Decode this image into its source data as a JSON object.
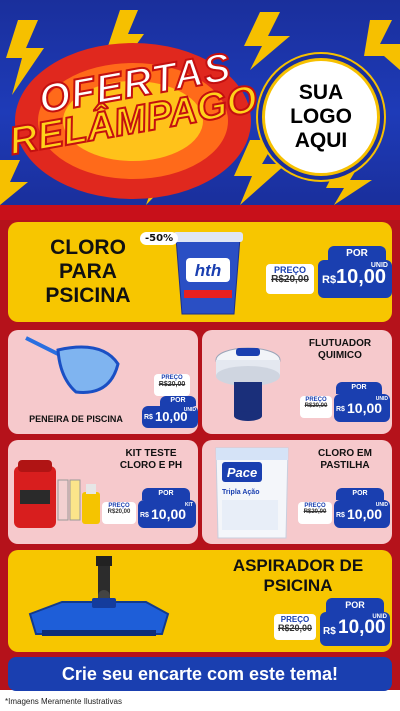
{
  "header": {
    "title_line1": "OFERTAS",
    "title_line2": "RELÂMPAGO",
    "logo_line1": "SUA",
    "logo_line2": "LOGO",
    "logo_line3": "AQUI"
  },
  "products": {
    "cloro": {
      "name_line1": "CLORO",
      "name_line2": "PARA",
      "name_line3": "PSICINA",
      "discount": "-50%",
      "brand": "hth",
      "por": "POR",
      "preco": "PREÇO",
      "old_price": "R$20,00",
      "currency": "R$",
      "price": "10,00",
      "unit": "UNID"
    },
    "peneira": {
      "name": "PENEIRA DE PISCINA",
      "por": "POR",
      "preco": "PREÇO",
      "old_price": "R$20,00",
      "currency": "R$",
      "price": "10,00",
      "unit": "UNID"
    },
    "flutuador": {
      "name_line1": "FLUTUADOR",
      "name_line2": "QUIMICO",
      "por": "POR",
      "preco": "PREÇO",
      "old_price": "R$20,00",
      "currency": "R$",
      "price": "10,00",
      "unit": "UNID"
    },
    "kit": {
      "name_line1": "KIT TESTE",
      "name_line2": "CLORO E PH",
      "por": "POR",
      "preco": "PREÇO",
      "old_price": "R$20,00",
      "currency": "R$",
      "price": "10,00",
      "unit": "KIT"
    },
    "pastilha": {
      "name_line1": "CLORO EM",
      "name_line2": "PASTILHA",
      "brand": "Pace",
      "sub": "Tripla Ação",
      "por": "POR",
      "preco": "PREÇO",
      "old_price": "R$20,00",
      "currency": "R$",
      "price": "10,00",
      "unit": "UNID"
    },
    "aspirador": {
      "name_line1": "ASPIRADOR DE",
      "name_line2": "PSICINA",
      "por": "POR",
      "preco": "PREÇO",
      "old_price": "R$20,00",
      "currency": "R$",
      "price": "10,00",
      "unit": "UNID"
    }
  },
  "footer": {
    "cta": "Crie seu encarte com este tema!",
    "disclaimer": "*Imagens Meramente Ilustrativas"
  },
  "colors": {
    "blue": "#1a3fb0",
    "yellow": "#f7c600",
    "red": "#b5121b",
    "pink": "#f6c9cc"
  }
}
